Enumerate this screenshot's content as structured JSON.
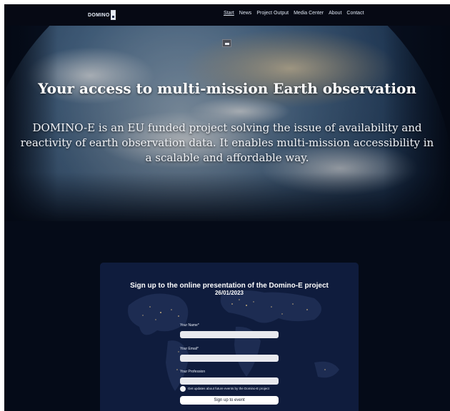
{
  "header": {
    "logo_text": "DOMINO",
    "nav": [
      {
        "label": "Start",
        "active": true
      },
      {
        "label": "News"
      },
      {
        "label": "Project Output"
      },
      {
        "label": "Media Center"
      },
      {
        "label": "About"
      },
      {
        "label": "Contact"
      }
    ]
  },
  "hero": {
    "title": "Your access to multi-mission Earth observation",
    "description": "DOMINO-E is an EU funded project solving the issue of availability and reactivity of earth observation data. It enables multi-mission accessibility in a scalable and affordable way.",
    "image_icon": "image-icon"
  },
  "signup": {
    "title": "Sign up to the online presentation of the Domino-E project",
    "date": "26/01/2023",
    "fields": [
      {
        "label": "Your Name*",
        "value": ""
      },
      {
        "label": "Your Email*",
        "value": ""
      },
      {
        "label": "Your Profession",
        "value": ""
      }
    ],
    "checkbox_label": "Get updates about future events by the Domino-E project",
    "submit_label": "Sign up to event"
  },
  "colors": {
    "page_bg": "#050b18",
    "card_bg": "#0d1a3a",
    "text": "#ffffff"
  }
}
